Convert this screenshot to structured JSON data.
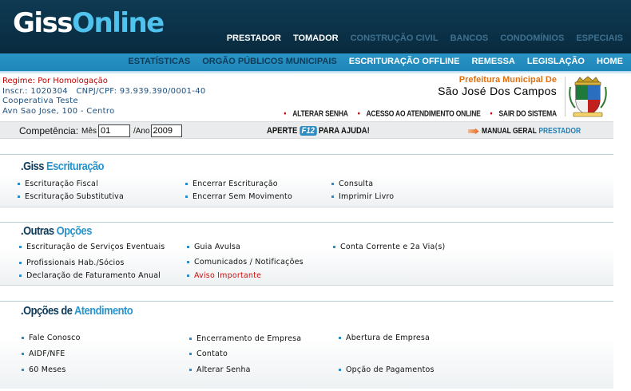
{
  "brand": {
    "part1": "Giss",
    "part2": "Online"
  },
  "top_nav": [
    {
      "label": "PRESTADOR",
      "state": "active"
    },
    {
      "label": "TOMADOR",
      "state": "active"
    },
    {
      "label": "CONSTRUÇÃO CIVIL",
      "state": "dim"
    },
    {
      "label": "BANCOS",
      "state": "dim"
    },
    {
      "label": "CONDOMÍNIOS",
      "state": "dim"
    },
    {
      "label": "ESPECIAIS",
      "state": "dim"
    }
  ],
  "second_nav": [
    {
      "label": "ESTATÍSTICAS",
      "state": "dim"
    },
    {
      "label": "ORGÃO PÚBLICOS MUNICIPAIS",
      "state": "dim"
    },
    {
      "label": "ESCRITURAÇÃO OFFLINE",
      "state": "lit"
    },
    {
      "label": "REMESSA",
      "state": "lit"
    },
    {
      "label": "LEGISLAÇÃO",
      "state": "lit"
    },
    {
      "label": "HOME",
      "state": "lit"
    }
  ],
  "info": {
    "regime": "Regime: Por Homologação",
    "inscr": "Inscr.: 1020304   CNPJ/CPF: 93.939.390/0001-40",
    "company": "Cooperativa Teste",
    "address": "Avn Sao Jose, 100 - Centro"
  },
  "prefeitura": {
    "line1": "Prefeitura Municipal De",
    "line2": "São José Dos Campos"
  },
  "account_links": [
    "ALTERAR SENHA",
    "ACESSO AO ATENDIMENTO ONLINE",
    "SAIR DO SISTEMA"
  ],
  "competencia": {
    "label": "Competência:",
    "mes_label": "Mês",
    "mes_value": "01",
    "ano_label": "/Ano",
    "ano_value": "2009"
  },
  "help": {
    "before": "APERTE",
    "key": "F12",
    "after": "PARA AJUDA!"
  },
  "manual": {
    "text": "MANUAL GERAL",
    "highlight": "PRESTADOR"
  },
  "sections": {
    "escrituracao": {
      "title_pre": ".Giss",
      "title_post": "Escrituração",
      "items": [
        "Escrituração Fiscal",
        "Encerrar Escrituração",
        "Consulta",
        "Escrituração Substitutiva",
        "Encerrar Sem Movimento",
        "Imprimir Livro"
      ]
    },
    "outras": {
      "title_pre": ".Outras",
      "title_post": "Opções",
      "items": [
        "Escrituração de Serviços Eventuais",
        "Guia Avulsa",
        "Conta Corrente e 2a Via(s)",
        "Profissionais Hab./Sócios",
        "Comunicados / Notificações",
        "Declaração de Faturamento Anual",
        "Aviso Importante"
      ]
    },
    "atendimento": {
      "title_pre": ".Opções de",
      "title_post": "Atendimento",
      "items": [
        "Fale Conosco",
        "Encerramento de Empresa",
        "Abertura de Empresa",
        "AIDF/NFE",
        "Contato",
        "60 Meses",
        "Alterar Senha",
        "Opção de Pagamentos"
      ]
    }
  },
  "colors": {
    "header_dark": "#0b3147",
    "nav_blue": "#1f86b9",
    "accent_blue": "#2a94cc",
    "regime_red": "#c00000",
    "aviso_red": "#cc1010",
    "pref_orange": "#e07010"
  }
}
